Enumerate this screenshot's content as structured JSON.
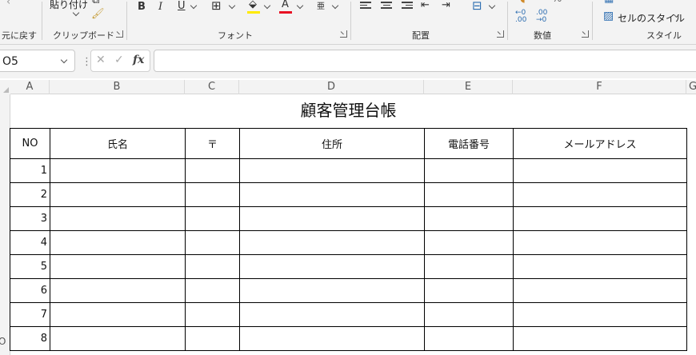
{
  "ribbon": {
    "undo_label": "元に戻す",
    "paste_label": "貼り付け",
    "clipboard_label": "クリップボード",
    "font_label": "フォント",
    "alignment_label": "配置",
    "number_label": "数値",
    "styles_label": "スタイル",
    "cell_styles_label": "セルのスタイル",
    "bold": "B",
    "italic": "I",
    "underline": "U",
    "font_color_letter": "A",
    "phonetic_glyph": "亜",
    "fill_color": "#ffeb00",
    "font_color": "#e81123",
    "inc_decimal": "←0 .00",
    "dec_decimal": ".00 →0"
  },
  "formula_bar": {
    "name_box": "O5",
    "separator": "⋮",
    "cancel_glyph": "✕",
    "enter_glyph": "✓",
    "fx_label": "fx",
    "formula_value": ""
  },
  "sheet": {
    "columns": [
      "A",
      "B",
      "C",
      "D",
      "E",
      "F",
      "G"
    ],
    "partial_row_label": "O",
    "title": "顧客管理台帳",
    "headers": [
      "NO",
      "氏名",
      "〒",
      "住所",
      "電話番号",
      "メールアドレス"
    ],
    "row_numbers": [
      "1",
      "2",
      "3",
      "4",
      "5",
      "6",
      "7",
      "8"
    ]
  }
}
